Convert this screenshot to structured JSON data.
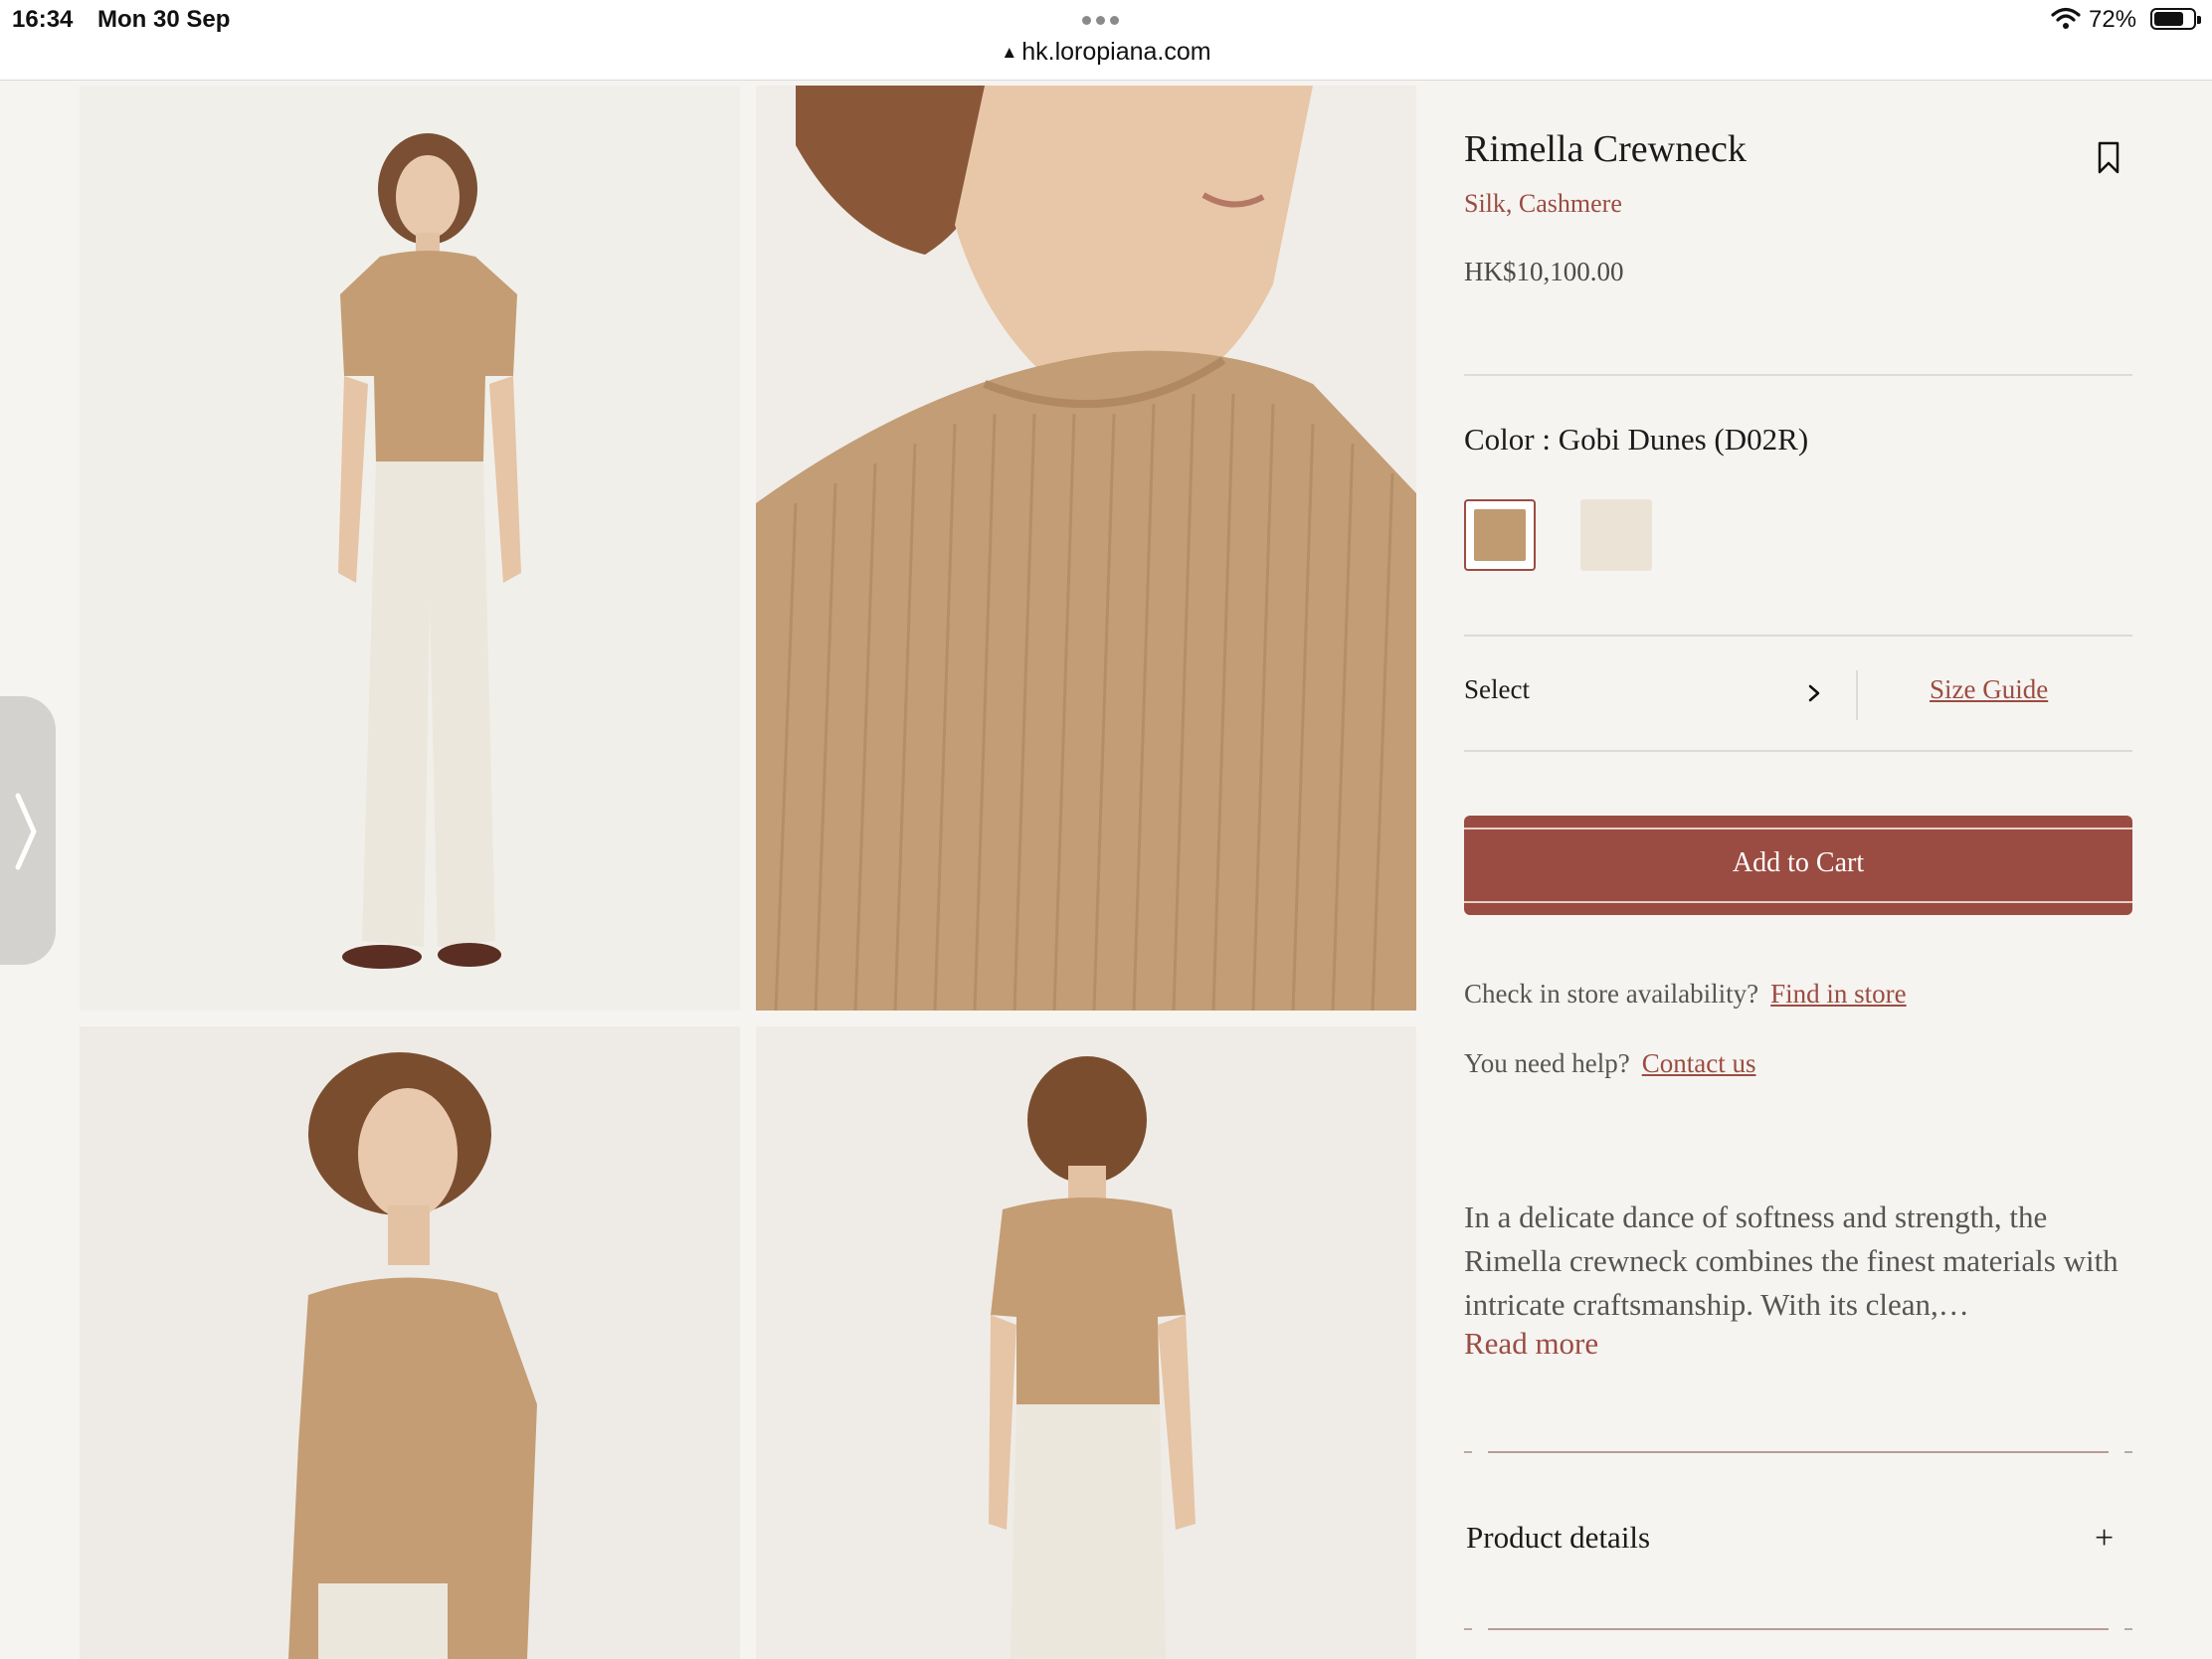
{
  "status_bar": {
    "time": "16:34",
    "date": "Mon 30 Sep",
    "url": "hk.loropiana.com",
    "battery": "72%"
  },
  "icons": {
    "lock": "lock-icon",
    "wifi": "wifi-icon",
    "battery": "battery-icon",
    "side_chevron": "chevron-right-icon",
    "zoom": "plus-icon",
    "bookmark": "bookmark-icon",
    "select_chevron": "chevron-right-icon",
    "accordion": "plus-icon"
  },
  "gallery": {
    "zoom_label": "+"
  },
  "product": {
    "title": "Rimella Crewneck",
    "materials": "Silk, Cashmere",
    "price": "HK$10,100.00",
    "color_label": "Color : Gobi Dunes (D02R)",
    "swatches": [
      {
        "color": "#c09a70",
        "selected": true
      },
      {
        "color": "#ebe4d6",
        "selected": false
      }
    ],
    "size_select_label": "Select",
    "size_guide": "Size Guide",
    "add_to_cart": "Add to Cart",
    "store_question": "Check in store availability?",
    "store_link": "Find in store",
    "help_question": "You need help?",
    "help_link": "Contact us",
    "description": "In a delicate dance of softness and strength, the Rimella crewneck combines the finest materials with intricate craftsmanship. With its clean,…",
    "read_more": "Read more",
    "accordion_title": "Product details",
    "accordion_icon": "+"
  },
  "colors": {
    "accent": "#9b4c42",
    "camel": "#c09a70",
    "cream": "#ebe4d6",
    "page_bg": "#f6f4f1"
  }
}
